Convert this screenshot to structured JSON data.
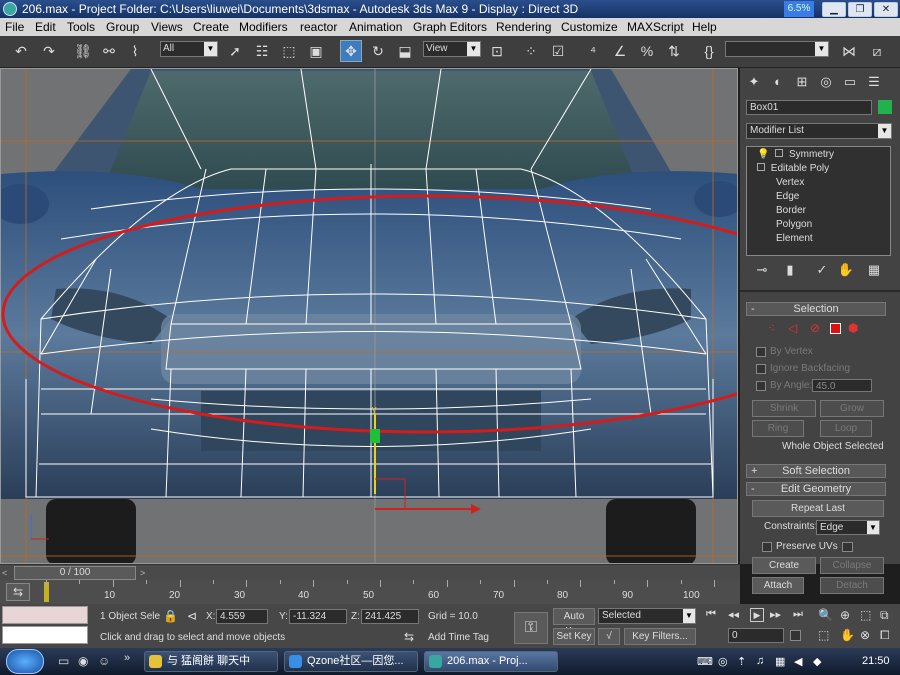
{
  "titlebar": {
    "text": "206.max    - Project Folder: C:\\Users\\liuwei\\Documents\\3dsmax      - Autodesk 3ds Max 9      - Display : Direct 3D",
    "cpu_meter": "6.5%"
  },
  "menubar": {
    "items": [
      "File",
      "Edit",
      "Tools",
      "Group",
      "Views",
      "Create",
      "Modifiers",
      "reactor",
      "Animation",
      "Graph Editors",
      "Rendering",
      "Customize",
      "MAXScript",
      "Help"
    ]
  },
  "toolbar": {
    "selection_filter": "All",
    "ref_coord": "View",
    "named_selection": ""
  },
  "viewport": {
    "gizmo_y": "y"
  },
  "command_panel": {
    "object_name": "Box01",
    "object_color": "#22b14c",
    "modifier_list": "Modifier List",
    "stack": [
      "Symmetry",
      "Editable Poly",
      "Vertex",
      "Edge",
      "Border",
      "Polygon",
      "Element"
    ],
    "selection_rollout": {
      "title": "Selection",
      "by_vertex": "By Vertex",
      "ignore_backfacing": "Ignore Backfacing",
      "by_angle": "By Angle:",
      "angle_value": "45.0",
      "shrink": "Shrink",
      "grow": "Grow",
      "ring": "Ring",
      "loop": "Loop",
      "status": "Whole Object Selected"
    },
    "soft_selection": "Soft Selection",
    "edit_geometry": {
      "title": "Edit Geometry",
      "repeat_last": "Repeat Last",
      "constraints_label": "Constraints:",
      "constraints_value": "Edge",
      "preserve_uvs": "Preserve UVs",
      "create": "Create",
      "collapse": "Collapse",
      "attach": "Attach",
      "detach": "Detach"
    }
  },
  "timeline": {
    "frame_readout": "0 / 100",
    "ticks": [
      "10",
      "20",
      "30",
      "40",
      "50",
      "60",
      "70",
      "80",
      "90",
      "100"
    ]
  },
  "status": {
    "selection": "1 Object Sele",
    "x_label": "X:",
    "x": "4.559",
    "y_label": "Y:",
    "y": "-11.324",
    "z_label": "Z:",
    "z": "241.425",
    "grid": "Grid = 10.0",
    "prompt": "Click and drag to select and move objects",
    "add_time_tag": "Add Time Tag",
    "auto_key": "Auto Key",
    "set_key": "Set Key",
    "key_filter": "Selected",
    "key_filters_btn": "Key Filters...",
    "current_frame": "0"
  },
  "taskbar": {
    "tasks": [
      "与 猛阁餅 聊天中",
      "Qzone社区—因您...",
      "206.max     - Proj..."
    ],
    "clock": "21:50"
  }
}
